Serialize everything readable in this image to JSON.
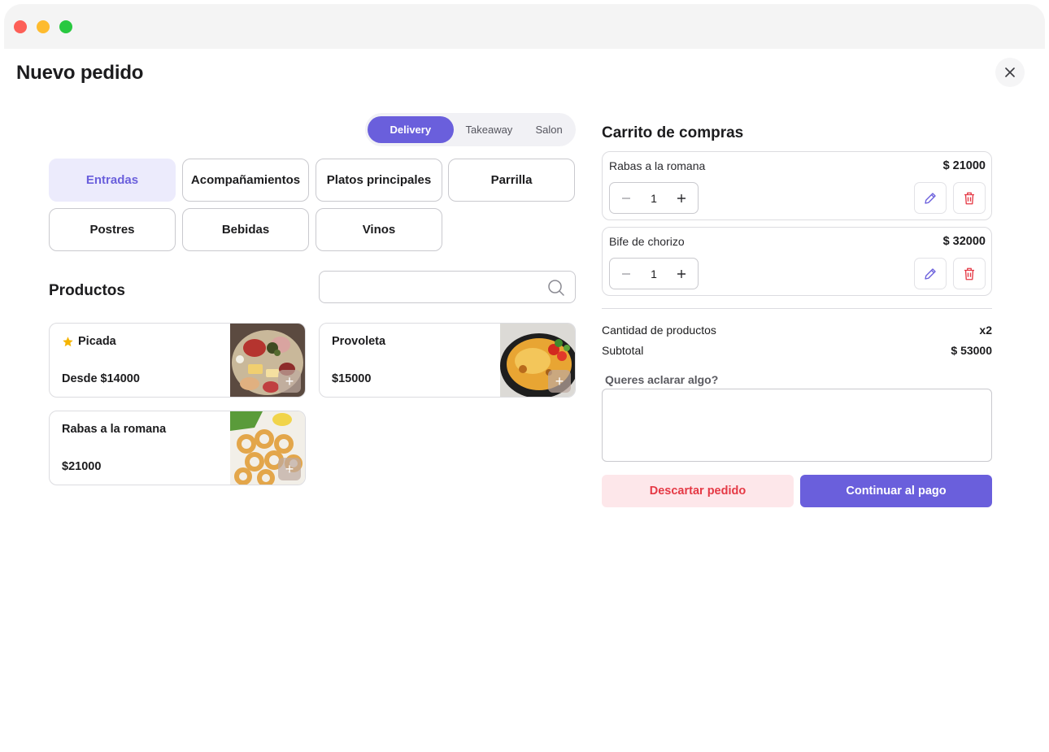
{
  "window": {
    "controls": [
      "close",
      "minimize",
      "maximize"
    ]
  },
  "page": {
    "title": "Nuevo pedido"
  },
  "order_type": {
    "options": [
      "Delivery",
      "Takeaway",
      "Salon"
    ],
    "selected": "Delivery"
  },
  "categories": {
    "items": [
      "Entradas",
      "Acompañamientos",
      "Platos principales",
      "Parrilla",
      "Postres",
      "Bebidas",
      "Vinos"
    ],
    "selected": "Entradas"
  },
  "products": {
    "title": "Productos",
    "search": {
      "value": "",
      "placeholder": ""
    },
    "items": [
      {
        "name": "Picada",
        "price": "Desde $14000",
        "starred": true,
        "image": "charcuterie-board"
      },
      {
        "name": "Provoleta",
        "price": "$15000",
        "starred": false,
        "image": "grilled-provolone-skillet"
      },
      {
        "name": "Rabas a la romana",
        "price": "$21000",
        "starred": false,
        "image": "fried-calamari"
      }
    ],
    "add_icon": "plus-icon"
  },
  "cart": {
    "title": "Carrito de compras",
    "items": [
      {
        "name": "Rabas a la romana",
        "price": "$ 21000",
        "qty": "1"
      },
      {
        "name": "Bife de chorizo",
        "price": "$ 32000",
        "qty": "1"
      }
    ],
    "summary": {
      "count_label": "Cantidad de productos",
      "count_value": "x2",
      "subtotal_label": "Subtotal",
      "subtotal_value": "$ 53000"
    },
    "note": {
      "label": "Queres aclarar algo?",
      "value": ""
    },
    "discard_label": "Descartar pedido",
    "continue_label": "Continuar al pago"
  },
  "colors": {
    "accent": "#6a5fdc",
    "accent_light": "#ecebfc",
    "danger": "#e53945",
    "danger_light": "#fde7ea",
    "star": "#f5b400"
  }
}
